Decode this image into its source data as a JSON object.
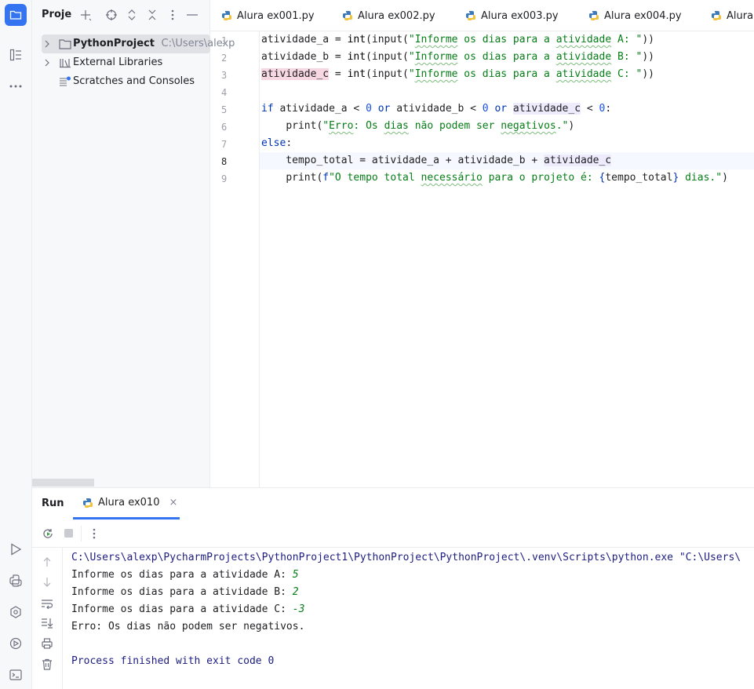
{
  "project_panel": {
    "title": "Proje",
    "tree": [
      {
        "label": "PythonProject",
        "path": "C:\\Users\\alexp"
      },
      {
        "label": "External Libraries"
      },
      {
        "label": "Scratches and Consoles"
      }
    ]
  },
  "editor": {
    "tabs": [
      {
        "label": "Alura ex001.py"
      },
      {
        "label": "Alura ex002.py"
      },
      {
        "label": "Alura ex003.py"
      },
      {
        "label": "Alura ex004.py"
      },
      {
        "label": "Alura"
      }
    ],
    "line_numbers": [
      "1",
      "2",
      "3",
      "4",
      "5",
      "6",
      "7",
      "8",
      "9"
    ],
    "current_line": "8"
  },
  "run_panel": {
    "title": "Run",
    "tab_label": "Alura ex010",
    "tab_close": "×",
    "console": {
      "command": "C:\\Users\\alexp\\PycharmProjects\\PythonProject1\\PythonProject\\PythonProject\\.venv\\Scripts\\python.exe \"C:\\Users\\",
      "prompt_a": "Informe os dias para a atividade A: ",
      "input_a": "5",
      "prompt_b": "Informe os dias para a atividade B: ",
      "input_b": "2",
      "prompt_c": "Informe os dias para a atividade C: ",
      "input_c": "-3",
      "error_line": "Erro: Os dias não podem ser negativos.",
      "exit_line": "Process finished with exit code 0"
    }
  },
  "colors": {
    "accent": "#3574f0",
    "keyword": "#0033b3",
    "string": "#067d17",
    "number": "#1750eb"
  },
  "icons": {
    "project": "folder-icon",
    "structure": "structure-icon",
    "more": "more-icon",
    "run": "run-icon",
    "python_console": "python-console-icon",
    "services": "services-icon",
    "debug": "debug-icon",
    "terminal": "terminal-icon"
  }
}
